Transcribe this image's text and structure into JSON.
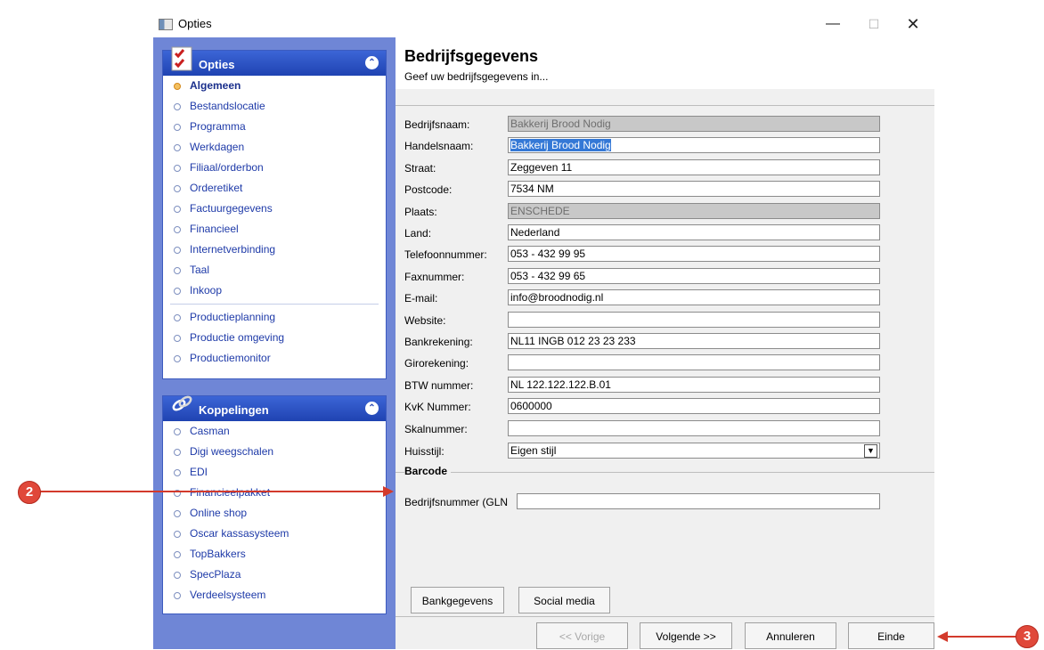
{
  "window": {
    "title": "Opties"
  },
  "sidebar": {
    "options_panel": {
      "title": "Opties",
      "items": [
        {
          "label": "Algemeen",
          "active": true
        },
        {
          "label": "Bestandslocatie"
        },
        {
          "label": "Programma"
        },
        {
          "label": "Werkdagen"
        },
        {
          "label": "Filiaal/orderbon"
        },
        {
          "label": "Orderetiket"
        },
        {
          "label": "Factuurgegevens"
        },
        {
          "label": "Financieel"
        },
        {
          "label": "Internetverbinding"
        },
        {
          "label": "Taal"
        },
        {
          "label": "Inkoop"
        }
      ],
      "production_items": [
        {
          "label": "Productieplanning"
        },
        {
          "label": "Productie omgeving"
        },
        {
          "label": "Productiemonitor"
        }
      ]
    },
    "links_panel": {
      "title": "Koppelingen",
      "items": [
        {
          "label": "Casman"
        },
        {
          "label": "Digi weegschalen"
        },
        {
          "label": "EDI"
        },
        {
          "label": "Financieelpakket"
        },
        {
          "label": "Online shop"
        },
        {
          "label": "Oscar kassasysteem"
        },
        {
          "label": "TopBakkers"
        },
        {
          "label": "SpecPlaza"
        },
        {
          "label": "Verdeelsysteem"
        }
      ]
    }
  },
  "header": {
    "title": "Bedrijfsgegevens",
    "subtitle": "Geef uw bedrijfsgegevens in..."
  },
  "form": {
    "fields": [
      {
        "label": "Bedrijfsnaam:",
        "value": "Bakkerij Brood Nodig",
        "readonly": true
      },
      {
        "label": "Handelsnaam:",
        "value": "Bakkerij Brood Nodig",
        "selected": true
      },
      {
        "label": "Straat:",
        "value": "Zeggeven 11"
      },
      {
        "label": "Postcode:",
        "value": "7534 NM"
      },
      {
        "label": "Plaats:",
        "value": "ENSCHEDE",
        "readonly": true
      },
      {
        "label": "Land:",
        "value": "Nederland"
      },
      {
        "label": "Telefoonnummer:",
        "value": "053 - 432 99 95"
      },
      {
        "label": "Faxnummer:",
        "value": "053 - 432 99 65"
      },
      {
        "label": "E-mail:",
        "value": "info@broodnodig.nl"
      },
      {
        "label": "Website:",
        "value": ""
      },
      {
        "label": "Bankrekening:",
        "value": "NL11 INGB 012 23 23 233"
      },
      {
        "label": "Girorekening:",
        "value": ""
      },
      {
        "label": "BTW nummer:",
        "value": "NL 122.122.122.B.01"
      },
      {
        "label": "KvK Nummer:",
        "value": "0600000"
      },
      {
        "label": "Skalnummer:",
        "value": ""
      }
    ],
    "huisstijl": {
      "label": "Huisstijl:",
      "value": "Eigen stijl"
    },
    "barcode": {
      "group_label": "Barcode",
      "gln_label": "Bedrijfsnummer (GLN",
      "gln_value": ""
    },
    "bank_button": "Bankgegevens",
    "social_button": "Social media"
  },
  "footer": {
    "prev": "<< Vorige",
    "next": "Volgende >>",
    "cancel": "Annuleren",
    "finish": "Einde"
  },
  "callouts": {
    "two": "2",
    "three": "3"
  },
  "colors": {
    "accent": "#2848b6",
    "sidebar_bg": "#6f86d6",
    "callout": "#e0483a"
  }
}
